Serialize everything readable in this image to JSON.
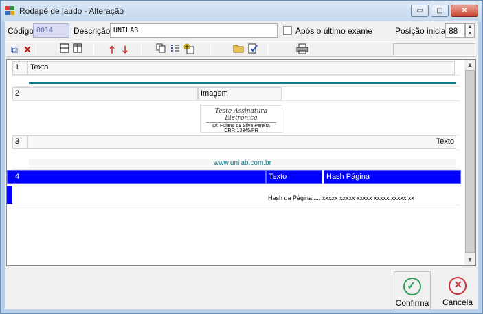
{
  "window": {
    "title": "Rodapé de laudo - Alteração",
    "minimize": "▭",
    "maximize": "▢",
    "close": "✕"
  },
  "form": {
    "codigo_label": "Código",
    "codigo_value": "0014",
    "descricao_label": "Descrição",
    "descricao_value": "UNILAB",
    "apos_label": "Após o último exame",
    "posicao_label": "Posição inicial",
    "posicao_value": "88"
  },
  "toolbar": [
    "add-layers-icon",
    "delete-icon",
    "row-split-icon",
    "column-split-icon",
    "move-up-icon",
    "move-down-icon",
    "copy-icon",
    "list-icon",
    "add-image-icon",
    "open-folder-icon",
    "check-doc-icon",
    "print-icon"
  ],
  "rows": [
    {
      "num": "1",
      "col1": "Texto"
    },
    {
      "num": "2",
      "col1": "Imagem"
    },
    {
      "num": "3",
      "col1": "Texto"
    },
    {
      "num": "4",
      "col1": "Texto",
      "col2": "Hash Página"
    }
  ],
  "signature": {
    "script": "Teste Assinatura Eletrônica",
    "name": "Dr. Fulano da Silva Pereira",
    "crf": "CRF: 12345/PR"
  },
  "website": "www.unilab.com.br",
  "hash_text": "Hash da Página..... xxxxx xxxxx xxxxx xxxxx xxxxx xx",
  "buttons": {
    "confirma": "Confirma",
    "cancela": "Cancela"
  },
  "colors": {
    "selection": "#0000ff",
    "confirm": "#2ea05a",
    "cancel": "#c8343a",
    "teal": "#0f7c8c"
  }
}
